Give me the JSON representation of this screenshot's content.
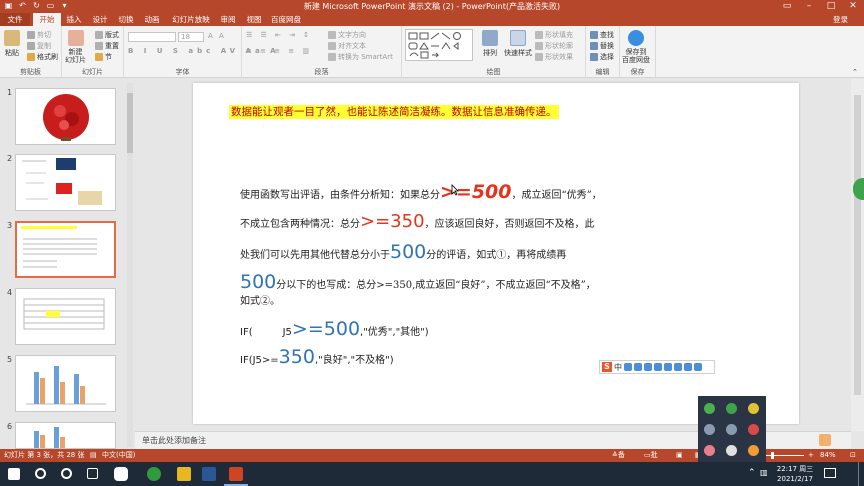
{
  "window": {
    "title": "新建 Microsoft PowerPoint 演示文稿 (2) - PowerPoint(产品激活失败)",
    "login": "登录"
  },
  "tabs": [
    "文件",
    "开始",
    "插入",
    "设计",
    "切换",
    "动画",
    "幻灯片放映",
    "审阅",
    "视图",
    "百度网盘"
  ],
  "ribbon": {
    "clipboard": {
      "paste": "粘贴",
      "cut": "剪切",
      "copy": "复制",
      "format_painter": "格式刷",
      "label": "剪贴板"
    },
    "slides": {
      "new_slide": "新建\n幻灯片",
      "layout": "版式",
      "reset": "重置",
      "section": "节",
      "label": "幻灯片"
    },
    "font": {
      "label": "字体",
      "size": "18"
    },
    "paragraph": {
      "text_direction": "文字方向",
      "align_text": "对齐文本",
      "smartart": "转换为 SmartArt",
      "label": "段落"
    },
    "drawing": {
      "arrange": "排列",
      "quick_styles": "快速样式",
      "fill": "形状填充",
      "outline": "形状轮廓",
      "effects": "形状效果",
      "label": "绘图"
    },
    "editing": {
      "find": "查找",
      "replace": "替换",
      "select": "选择",
      "label": "编辑"
    },
    "save": {
      "save_to_cloud": "保存到\n百度网盘",
      "label": "保存"
    }
  },
  "thumbnails": [
    "1",
    "2",
    "3",
    "4",
    "5",
    "6"
  ],
  "slide": {
    "highlight": "数据能让观者一目了然，也能让陈述简洁凝练。数据让信息准确传递。",
    "line1_a": "使用函数写出评语，由条件分析知：如果总分",
    "line1_b": ">=500",
    "line1_c": "，成立返回“优秀”，",
    "line2_a": "不成立包含两种情况：总分",
    "line2_b": ">=350",
    "line2_c": "，应该返回良好，否则返回不及格，此",
    "line3_a": "处我们可以先用其他代替总分小于",
    "line3_b": "500",
    "line3_c": "分的评语，如式①，再将成绩再",
    "line4_a": "500",
    "line4_b": "分以下的也写成：总分>=350,成立返回“良好”，不成立返回“不及格”，",
    "line5": "如式②。",
    "formula1_a": "IF(",
    "formula1_b": "J5",
    "formula1_c": ">=500",
    "formula1_d": ",\"优秀\",\"其他\")",
    "formula2_a": "IF(J5>=",
    "formula2_b": "350",
    "formula2_c": ",\"良好\",\"不及格\")"
  },
  "notes": {
    "placeholder": "单击此处添加备注"
  },
  "status": {
    "slide_info": "幻灯片 第 3 张，共 28 张",
    "language": "中文(中国)",
    "notes": "备注",
    "comments": "批注",
    "zoom": "84%"
  },
  "taskbar": {
    "time": "22:17 周三",
    "date": "2021/2/17",
    "ime": "中"
  },
  "colors": {
    "accent": "#b7472a",
    "highlight": "#ffff33",
    "red_number": "#e8331c",
    "blue_number": "#2e75b6"
  }
}
